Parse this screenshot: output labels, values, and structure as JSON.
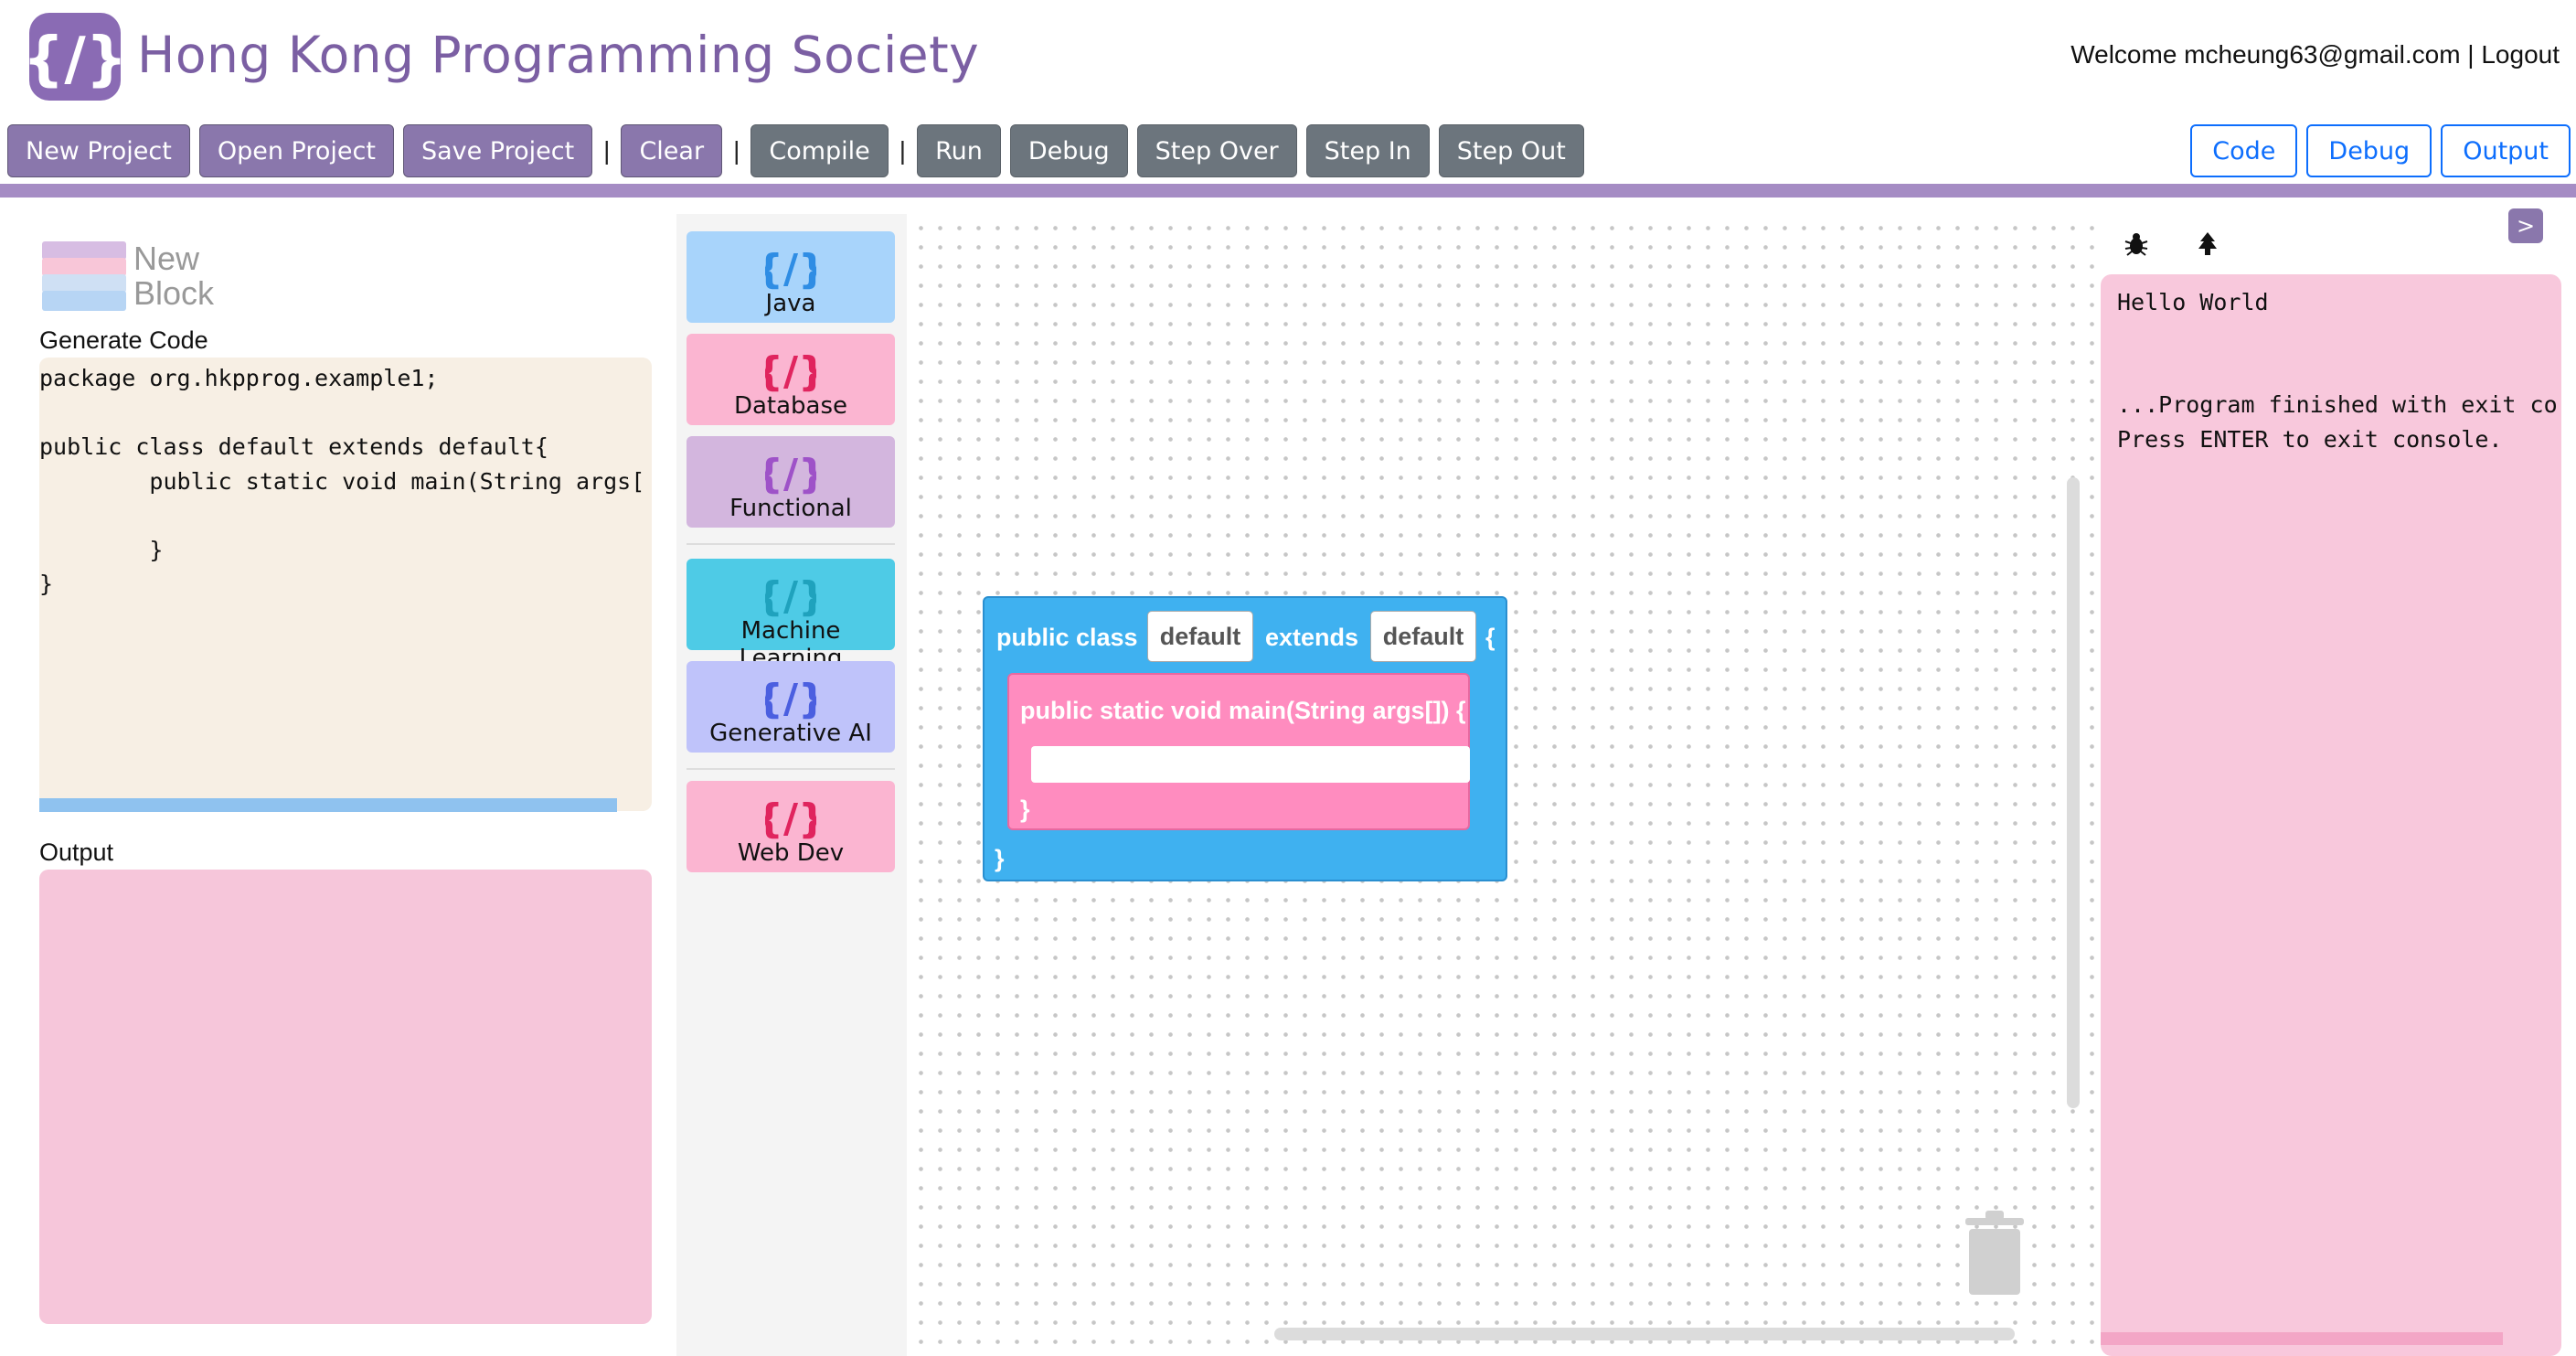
{
  "header": {
    "brand": "Hong Kong Programming Society",
    "welcome_prefix": "Welcome",
    "user_email": "mcheung63@gmail.com",
    "separator": "|",
    "logout": "Logout"
  },
  "toolbar": {
    "new_project": "New Project",
    "open_project": "Open Project",
    "save_project": "Save Project",
    "clear": "Clear",
    "compile": "Compile",
    "run": "Run",
    "debug": "Debug",
    "step_over": "Step Over",
    "step_in": "Step In",
    "step_out": "Step Out",
    "separator": "|"
  },
  "view_tabs": {
    "code": "Code",
    "debug": "Debug",
    "output": "Output"
  },
  "left_panel": {
    "new_block_line1": "New",
    "new_block_line2": "Block",
    "generate_code_label": "Generate Code",
    "code": "package org.hkpprog.example1;\n\npublic class default extends default{\n        public static void main(String args[\n\n        }\n}",
    "output_label": "Output"
  },
  "palette": {
    "categories": [
      {
        "label": "Java",
        "bg": "#a8d4fb",
        "icon_color": "#2f8de4"
      },
      {
        "label": "Database",
        "bg": "#fbb5d1",
        "icon_color": "#e0245e"
      },
      {
        "label": "Functional",
        "bg": "#d3b6de",
        "icon_color": "#9e52c8"
      },
      {
        "label": "Machine Learning",
        "bg": "#4ecbe6",
        "icon_color": "#1fa2bd"
      },
      {
        "label": "Generative AI",
        "bg": "#bfc3fa",
        "icon_color": "#4b5fe0"
      },
      {
        "label": "Web Dev",
        "bg": "#fbb5d1",
        "icon_color": "#e0245e"
      }
    ]
  },
  "workspace": {
    "class_block": {
      "public_class": "public class",
      "class_name": "default",
      "extends": "extends",
      "parent_name": "default",
      "open_brace": "{",
      "close_brace": "}"
    },
    "main_block": {
      "signature": "public static void main(String args[]) {",
      "close_brace": "}"
    }
  },
  "right_panel": {
    "collapse_label": ">",
    "console_lines": [
      "Hello World",
      "",
      "",
      "...Program finished with exit co",
      "Press ENTER to exit console."
    ]
  },
  "colors": {
    "brand": "#7b5fa3",
    "toolbar_purple": "#8a77ac",
    "toolbar_gray": "#6c757d",
    "accent_blue": "#0d6efd",
    "divider": "#a58cc4",
    "class_block": "#3fb1f0",
    "main_block": "#ff8cbf",
    "console_bg": "#f8c8dc"
  }
}
